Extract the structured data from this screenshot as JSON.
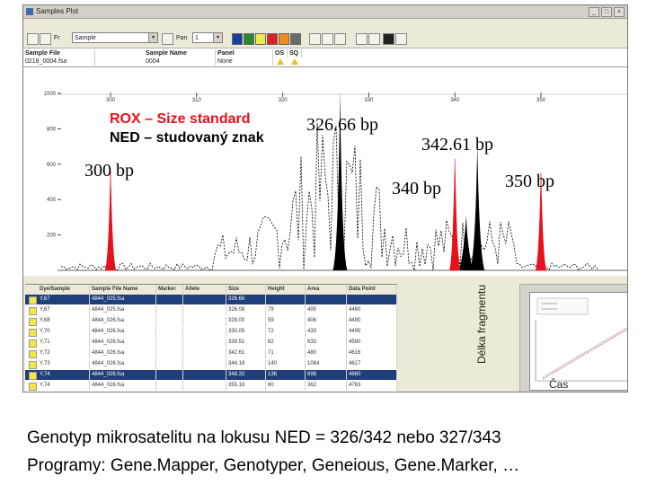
{
  "window": {
    "title": "Samples Plot",
    "controls": [
      "_",
      "□",
      "×"
    ]
  },
  "toolbar": {
    "filter_label": "Fr",
    "view_select": "Sample",
    "panel_label": "Pan",
    "panel_select": "1",
    "panel_caret": "▾",
    "swatch_colors": [
      "#1a3ea0",
      "#2a8a2a",
      "#f2e84a",
      "#e02020",
      "#f08a1a",
      "#6a6a6a"
    ]
  },
  "grid": {
    "headers": [
      "Sample File",
      "Sample Name",
      "Panel",
      "OS",
      "SQ"
    ],
    "row": [
      "0218_0004.fsa",
      "0004",
      "None",
      "",
      ""
    ]
  },
  "plot": {
    "x_ticks": [
      "300",
      "310",
      "320",
      "330",
      "340",
      "350"
    ],
    "y_ticks": [
      "1000",
      "800",
      "600",
      "400",
      "200"
    ],
    "annotations": {
      "rox": "ROX – Size standard",
      "ned": "NED – studovaný znak",
      "peak_326": "326.66 bp",
      "peak_342": "342.61 bp",
      "bp_300": "300 bp",
      "bp_340": "340 bp",
      "bp_350": "350 bp"
    },
    "colors": {
      "rox": "#e8101a",
      "ned": "#000000"
    }
  },
  "table": {
    "headers": [
      "Dye/Sample",
      "Sample File Name",
      "Marker",
      "Allele",
      "Size",
      "Height",
      "Area",
      "Data Point"
    ],
    "rows": [
      {
        "cells": [
          "Y,67",
          "4844_025.fsa",
          "",
          "",
          "326.66",
          "",
          "",
          ""
        ],
        "selected": true
      },
      {
        "cells": [
          "Y,67",
          "4844_025.fsa",
          "",
          "",
          "326.08",
          "79",
          "495",
          "4460"
        ],
        "selected": false
      },
      {
        "cells": [
          "Y,68",
          "4844_026.fsa",
          "",
          "",
          "328.00",
          "59",
          "406",
          "4480"
        ],
        "selected": false
      },
      {
        "cells": [
          "Y,70",
          "4844_026.fsa",
          "",
          "",
          "330.05",
          "72",
          "433",
          "4495"
        ],
        "selected": false
      },
      {
        "cells": [
          "Y,71",
          "4844_026.fsa",
          "",
          "",
          "339.51",
          "82",
          "633",
          "4590"
        ],
        "selected": false
      },
      {
        "cells": [
          "Y,72",
          "4844_026.fsa",
          "",
          "",
          "342.61",
          "71",
          "480",
          "4616"
        ],
        "selected": false
      },
      {
        "cells": [
          "Y,73",
          "4844_026.fsa",
          "",
          "",
          "344.18",
          "140",
          "1084",
          "4627"
        ],
        "selected": false
      },
      {
        "cells": [
          "Y,74",
          "4844_026.fsa",
          "",
          "",
          "348.32",
          "136",
          "698",
          "4660"
        ],
        "selected": true
      },
      {
        "cells": [
          "Y,74",
          "4844_026.fsa",
          "",
          "",
          "355.18",
          "60",
          "362",
          "4763"
        ],
        "selected": false
      }
    ]
  },
  "mini_chart": {
    "ylabel": "Délka fragmentu",
    "xlabel": "Čas"
  },
  "caption": {
    "line1": "Genotyp mikrosatelitu na lokusu NED = 326/342 nebo 327/343",
    "line2": "Programy: Gene.Mapper, Genotyper, Geneious, Gene.Marker, …"
  }
}
